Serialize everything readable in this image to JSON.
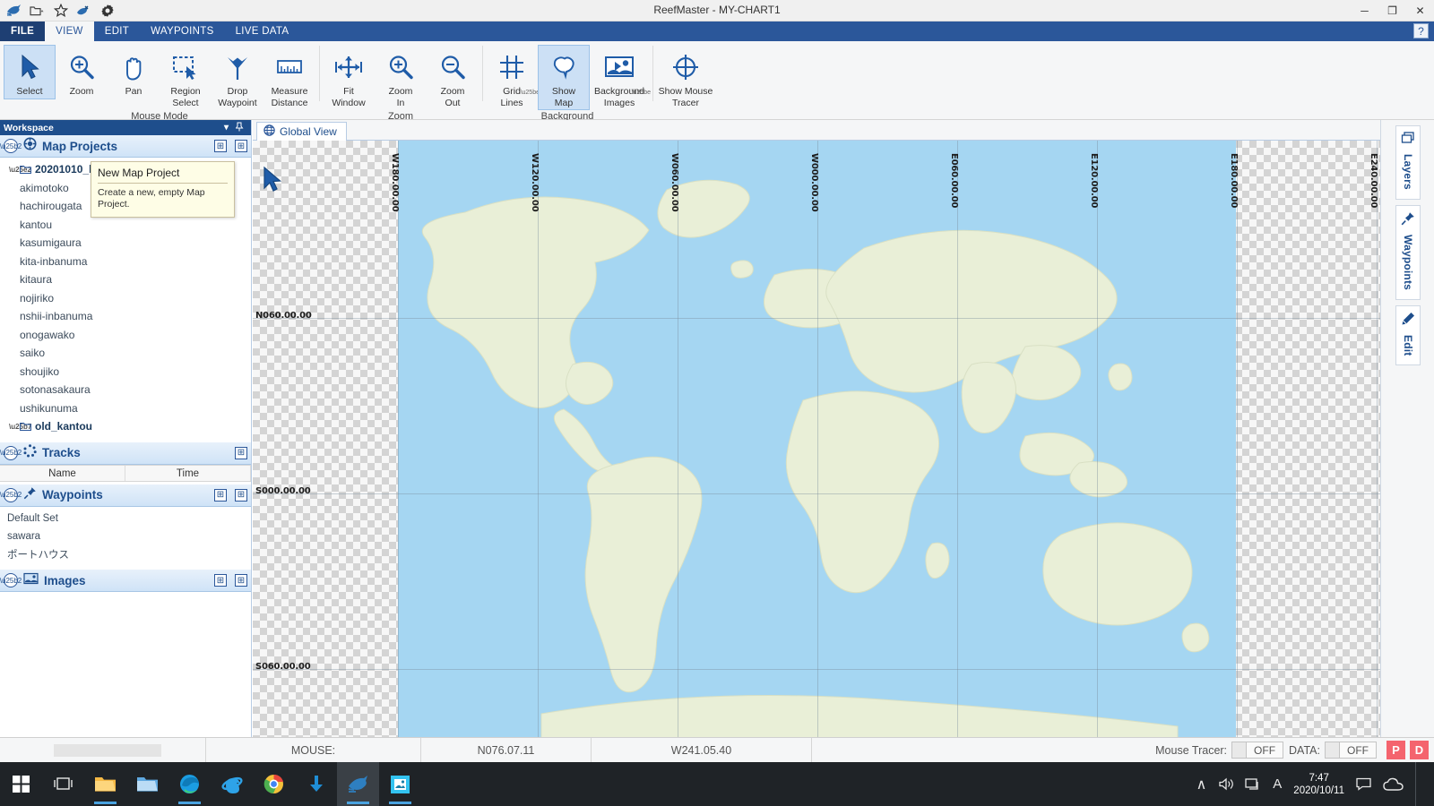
{
  "window": {
    "title": "ReefMaster - MY-CHART1",
    "minimize_label": "─",
    "restore_label": "❐",
    "close_label": "✕",
    "help_label": "?"
  },
  "quick_access": [
    {
      "name": "reefmaster-logo-icon",
      "label": "ReefMaster"
    },
    {
      "name": "open-folder-icon",
      "label": "Open"
    },
    {
      "name": "favorites-star-icon",
      "label": "Favorites"
    },
    {
      "name": "customize-qat-icon",
      "label": "Customize Quick Access Toolbar"
    },
    {
      "name": "settings-gear-icon",
      "label": "Settings"
    }
  ],
  "ribbon_tabs": [
    {
      "label": "FILE",
      "active": false,
      "file": true
    },
    {
      "label": "VIEW",
      "active": true,
      "file": false
    },
    {
      "label": "EDIT",
      "active": false,
      "file": false
    },
    {
      "label": "WAYPOINTS",
      "active": false,
      "file": false
    },
    {
      "label": "LIVE DATA",
      "active": false,
      "file": false
    }
  ],
  "ribbon_groups": [
    {
      "group_label": "Mouse Mode",
      "buttons": [
        {
          "label_line1": "Select",
          "label_line2": "",
          "icon": "cursor-arrow-icon",
          "selected": true
        },
        {
          "label_line1": "Zoom",
          "label_line2": "",
          "icon": "magnifier-plus-icon",
          "selected": false
        },
        {
          "label_line1": "Pan",
          "label_line2": "",
          "icon": "hand-icon",
          "selected": false
        },
        {
          "label_line1": "Region",
          "label_line2": "Select",
          "icon": "region-select-icon",
          "selected": false
        },
        {
          "label_line1": "Drop",
          "label_line2": "Waypoint",
          "icon": "waypoint-drop-icon",
          "selected": false
        },
        {
          "label_line1": "Measure",
          "label_line2": "Distance",
          "icon": "ruler-icon",
          "selected": false
        }
      ]
    },
    {
      "group_label": "Zoom",
      "buttons": [
        {
          "label_line1": "Fit",
          "label_line2": "Window",
          "icon": "fit-window-icon",
          "selected": false
        },
        {
          "label_line1": "Zoom",
          "label_line2": "In",
          "icon": "zoom-in-icon",
          "selected": false
        },
        {
          "label_line1": "Zoom",
          "label_line2": "Out",
          "icon": "zoom-out-icon",
          "selected": false
        }
      ]
    },
    {
      "group_label": "Background",
      "buttons": [
        {
          "label_line1": "Grid",
          "label_line2": "Lines",
          "icon": "grid-lines-icon",
          "selected": false,
          "dropdown": true
        },
        {
          "label_line1": "Show",
          "label_line2": "Map",
          "icon": "show-map-icon",
          "selected": true
        },
        {
          "label_line1": "Background",
          "label_line2": "Images",
          "icon": "background-images-icon",
          "selected": false,
          "dropdown": true
        }
      ]
    },
    {
      "group_label": "",
      "buttons": [
        {
          "label_line1": "Show Mouse",
          "label_line2": "Tracer",
          "icon": "crosshair-icon",
          "selected": false
        }
      ]
    }
  ],
  "workspace": {
    "header_title": "Workspace",
    "header_dropdown": "▾",
    "header_pin": "📌",
    "panels": {
      "map_projects": {
        "title": "Map Projects",
        "icon": "target-icon",
        "collapse_icon": "chevron-up-icon",
        "btn_new": "⊞",
        "btn_add": "⊞",
        "root_folder": "20201010_k",
        "items": [
          "akimotoko",
          "hachirougata",
          "kantou",
          "kasumigaura",
          "kita-inbanuma",
          "kitaura",
          "nojiriko",
          "nshii-inbanuma",
          "onogawako",
          "saiko",
          "shoujiko",
          "sotonasakaura",
          "ushikunuma"
        ],
        "second_folder": "old_kantou"
      },
      "tracks": {
        "title": "Tracks",
        "icon": "tracks-icon",
        "collapse_icon": "chevron-up-icon",
        "btn_add": "⊞",
        "columns": [
          "Name",
          "Time"
        ],
        "rows": []
      },
      "waypoints": {
        "title": "Waypoints",
        "icon": "pin-icon",
        "collapse_icon": "chevron-up-icon",
        "btn_new": "⊞",
        "btn_add": "⊞",
        "items": [
          "Default Set",
          "sawara",
          "ポートハウス"
        ]
      },
      "images": {
        "title": "Images",
        "icon": "image-icon",
        "collapse_icon": "chevron-up-icon",
        "btn_new": "⊞",
        "btn_add": "⊞",
        "items": []
      }
    }
  },
  "tooltip": {
    "title": "New Map Project",
    "body": "Create a new, empty Map Project."
  },
  "map": {
    "tab_label": "Global View",
    "tab_icon": "globe-icon",
    "cursor_icon": "cursor-arrow-icon",
    "lat_labels": [
      "N060.00.00",
      "S000.00.00",
      "S060.00.00"
    ],
    "lon_labels": [
      "W180.00.00",
      "W120.00.00",
      "W060.00.00",
      "W000.00.00",
      "E060.00.00",
      "E120.00.00",
      "E180.00.00",
      "E240.00.00"
    ],
    "ocean_color": "#a5d6f2",
    "land_color": "#e9efd7"
  },
  "side_tabs": [
    {
      "label": "Layers",
      "icon": "layers-icon"
    },
    {
      "label": "Waypoints",
      "icon": "pin-icon"
    },
    {
      "label": "Edit",
      "icon": "pencil-icon"
    }
  ],
  "status_bar": {
    "mouse_label": "MOUSE:",
    "latitude": "N076.07.11",
    "longitude": "W241.05.40",
    "mouse_tracer_label": "Mouse Tracer:",
    "mouse_tracer_state": "OFF",
    "data_label": "DATA:",
    "data_state": "OFF",
    "badge_p": "P",
    "badge_d": "D"
  },
  "taskbar": {
    "items": [
      {
        "name": "start-button",
        "label": "Start"
      },
      {
        "name": "task-view-button",
        "label": "Task View"
      },
      {
        "name": "file-explorer-button",
        "label": "File Explorer"
      },
      {
        "name": "folder-button",
        "label": "Folder"
      },
      {
        "name": "edge-button",
        "label": "Microsoft Edge"
      },
      {
        "name": "internet-explorer-button",
        "label": "Internet Explorer"
      },
      {
        "name": "chrome-button",
        "label": "Google Chrome"
      },
      {
        "name": "download-button",
        "label": "Downloads"
      },
      {
        "name": "reefmaster-button",
        "label": "ReefMaster"
      },
      {
        "name": "app-button",
        "label": "App"
      }
    ],
    "tray": {
      "chevron": "∧",
      "volume": "volume-icon",
      "network": "network-icon",
      "language": "A",
      "time": "7:47",
      "date": "2020/10/11",
      "notifications": "notification-icon",
      "cloud": "cloud-icon"
    }
  }
}
